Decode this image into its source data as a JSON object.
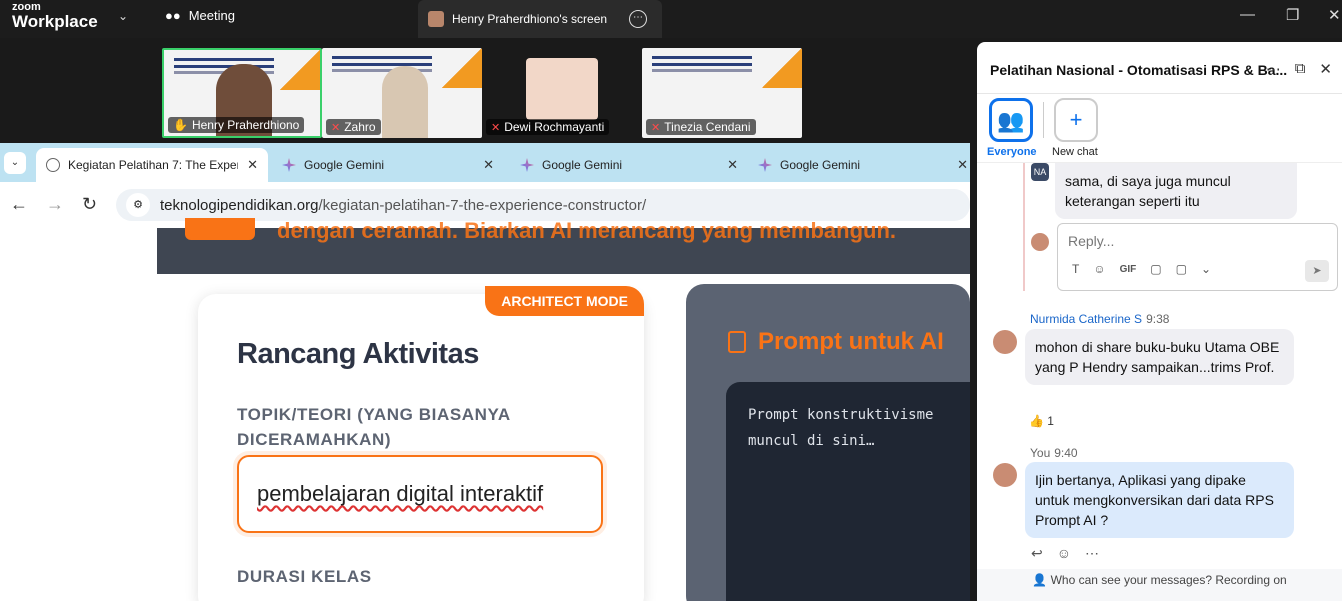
{
  "zoom": {
    "logo_line1": "zoom",
    "logo_line2": "Workplace",
    "chevron": "⌄",
    "meeting_label": "Meeting",
    "meeting_icon": "people-icon",
    "share_tab_label": "Henry Praherdhiono's screen",
    "share_more": "⋯",
    "window_controls": {
      "minimize": "—",
      "maximize": "❐",
      "close": "✕"
    }
  },
  "gallery": [
    {
      "name": "Henry Praherdhiono",
      "muted": false,
      "active": true
    },
    {
      "name": "Zahro",
      "muted": true,
      "active": false
    },
    {
      "name": "Dewi Rochmayanti",
      "muted": true,
      "active": false
    },
    {
      "name": "Tinezia Cendani",
      "muted": true,
      "active": false
    }
  ],
  "browser": {
    "tab_list_button": "⌄",
    "tabs": [
      {
        "label": "Kegiatan Pelatihan 7: The Exper",
        "close": "✕"
      },
      {
        "label": "Google Gemini",
        "close": "✕"
      },
      {
        "label": "Google Gemini",
        "close": "✕"
      },
      {
        "label": "Google Gemini",
        "close": "✕"
      }
    ],
    "nav": {
      "back": "←",
      "forward": "→",
      "reload": "↻"
    },
    "url_domain": "teknologipendidikan.org",
    "url_path": "/kegiatan-pelatihan-7-the-experience-constructor/",
    "site_settings_icon": "⚙"
  },
  "page": {
    "hero_text": "dengan ceramah. Biarkan AI merancang yang membangun.",
    "card": {
      "badge": "ARCHITECT MODE",
      "heading": "Rancang Aktivitas",
      "topic_label_line1": "TOPIK/TEORI (YANG BIASANYA",
      "topic_label_line2": "DICERAMAHKAN)",
      "topic_value": "pembelajaran digital interaktif",
      "duration_label": "DURASI KELAS"
    },
    "prompt_panel": {
      "title": "Prompt untuk AI",
      "placeholder": "Prompt konstruktivisme\nmuncul di sini…"
    }
  },
  "chat": {
    "title": "Pelatihan Nasional - Otomatisasi RPS & Ba...",
    "header_icons": {
      "more": "⋯",
      "popout": "⧉",
      "close": "✕"
    },
    "channels": [
      {
        "label": "Everyone",
        "icon": "👥",
        "selected": true
      },
      {
        "label": "New chat",
        "icon": "+",
        "selected": false
      }
    ],
    "thread_reply": {
      "avatar_text": "NA",
      "text": "sama, di saya juga muncul keterangan seperti itu"
    },
    "reply_placeholder": "Reply...",
    "reply_tools": [
      "T",
      "☺",
      "GIF",
      "▢",
      "▢",
      "⌄"
    ],
    "send_icon": "➤",
    "messages": [
      {
        "sender": "Nurmida Catherine S",
        "time": "9:38",
        "text": "mohon di share buku-buku Utama OBE yang P Hendry sampaikan...trims Prof.",
        "reaction": "👍",
        "reaction_count": "1"
      },
      {
        "sender": "You",
        "time": "9:40",
        "text": "Ijin bertanya, Aplikasi yang dipake untuk mengkonversikan dari data RPS Prompt AI ?"
      }
    ],
    "message_actions": [
      "↩",
      "☺",
      "⋯"
    ],
    "footer": "Who can see your messages? Recording on"
  }
}
